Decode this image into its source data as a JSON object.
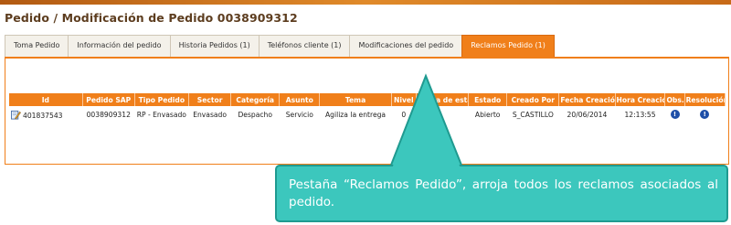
{
  "page_title": "Pedido / Modificación de Pedido 0038909312",
  "tabs": [
    {
      "label": "Toma Pedido"
    },
    {
      "label": "Información del pedido"
    },
    {
      "label": "Historia Pedidos (1)"
    },
    {
      "label": "Teléfonos cliente (1)"
    },
    {
      "label": "Modificaciones del pedido"
    },
    {
      "label": "Reclamos Pedido (1)"
    }
  ],
  "active_tab_index": 5,
  "table": {
    "headers": [
      "Id",
      "Pedido SAP",
      "Tipo Pedido",
      "Sector",
      "Categoría",
      "Asunto",
      "Tema",
      "Nivel",
      "Fecha de estado",
      "Estado",
      "Creado Por",
      "Fecha Creación",
      "Hora Creación",
      "Obs.",
      "Resolución"
    ],
    "rows": [
      {
        "id": "401837543",
        "pedido_sap": "0038909312",
        "tipo_pedido": "RP - Envasado",
        "sector": "Envasado",
        "categoria": "Despacho",
        "asunto": "Servicio",
        "tema": "Agiliza la entrega",
        "nivel": "0",
        "fecha_estado": "",
        "estado": "Abierto",
        "creado_por": "S_CASTILLO",
        "fecha_creacion": "20/06/2014",
        "hora_creacion": "12:13:55"
      }
    ]
  },
  "callout": {
    "text": "Pestaña “Reclamos Pedido”, arroja todos los reclamos asociados al pedido."
  },
  "colors": {
    "accent": "#f07f1a",
    "callout_fill": "#3cc7bd",
    "callout_border": "#1f9a90",
    "info_icon": "#1e4fa8",
    "title_color": "#5d3d1f"
  }
}
